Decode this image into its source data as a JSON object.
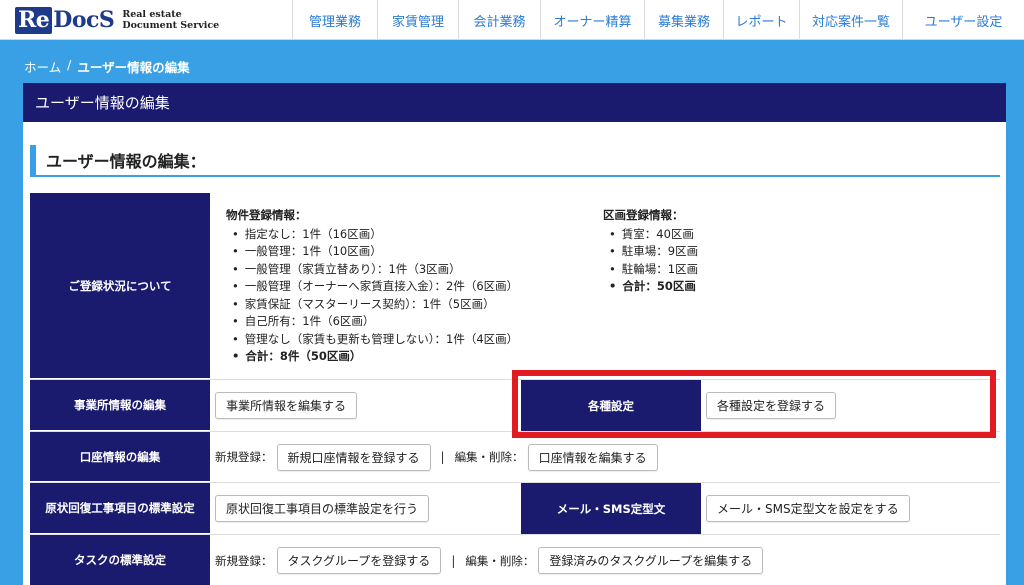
{
  "header": {
    "logo_re": "Re",
    "logo_docs": "DocS",
    "logo_tag_line1": "Real estate",
    "logo_tag_line2": "Document Service",
    "nav": [
      "管理業務",
      "家賃管理",
      "会計業務",
      "オーナー精算",
      "募集業務",
      "レポート",
      "対応案件一覧",
      "ユーザー設定"
    ]
  },
  "breadcrumb": {
    "home": "ホーム",
    "separator": "/",
    "current": "ユーザー情報の編集"
  },
  "panel": {
    "title": "ユーザー情報の編集"
  },
  "section": {
    "title": "ユーザー情報の編集："
  },
  "registration": {
    "label": "ご登録状況について",
    "property": {
      "heading": "物件登録情報：",
      "items": [
        "指定なし：1件（16区画）",
        "一般管理：1件（10区画）",
        "一般管理（家賃立替あり）：1件（3区画）",
        "一般管理（オーナーへ家賃直接入金）：2件（6区画）",
        "家賃保証（マスターリース契約）：1件（5区画）",
        "自己所有：1件（6区画）",
        "管理なし（家賃も更新も管理しない）：1件（4区画）"
      ],
      "total": "合計：8件（50区画）"
    },
    "unit": {
      "heading": "区画登録情報：",
      "items": [
        "賃室：40区画",
        "駐車場：9区画",
        "駐輪場：1区画"
      ],
      "total": "合計：50区画"
    }
  },
  "office": {
    "label": "事業所情報の編集",
    "button": "事業所情報を編集する"
  },
  "settings": {
    "label": "各種設定",
    "button": "各種設定を登録する"
  },
  "account": {
    "label": "口座情報の編集",
    "new_label": "新規登録：",
    "new_button": "新規口座情報を登録する",
    "sep": "|",
    "edit_label": "編集・削除：",
    "edit_button": "口座情報を編集する"
  },
  "restoration": {
    "label": "原状回復工事項目の標準設定",
    "button": "原状回復工事項目の標準設定を行う"
  },
  "mail": {
    "label": "メール・SMS定型文",
    "button": "メール・SMS定型文を設定をする"
  },
  "task": {
    "label": "タスクの標準設定",
    "new_label": "新規登録：",
    "new_button": "タスクグループを登録する",
    "sep": "|",
    "edit_label": "編集・削除：",
    "edit_button": "登録済みのタスクグループを編集する"
  },
  "colors": {
    "navy": "#1a1a6e",
    "sky": "#3aa0e6",
    "highlight": "#e21b23",
    "link": "#2a7bd4"
  }
}
